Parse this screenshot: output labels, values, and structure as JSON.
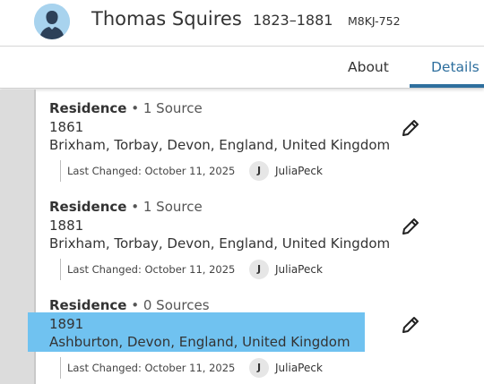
{
  "person": {
    "name": "Thomas Squires",
    "lifespan": "1823–1881",
    "id": "M8KJ-752",
    "avatar_icon": "person-silhouette-icon"
  },
  "tabs": [
    {
      "label": "About",
      "active": false
    },
    {
      "label": "Details",
      "active": true
    }
  ],
  "colors": {
    "accent": "#2e6f9e",
    "selection_highlight": "#70c2f0",
    "left_rail": "#dcdcdc"
  },
  "entries": [
    {
      "label": "Residence",
      "separator": "•",
      "sources": "1 Source",
      "year": "1861",
      "place": "Brixham, Torbay, Devon, England, United Kingdom",
      "last_changed": "Last Changed: October 11, 2025",
      "user_initial": "J",
      "user": "JuliaPeck",
      "edit_icon": "pencil-icon"
    },
    {
      "label": "Residence",
      "separator": "•",
      "sources": "1 Source",
      "year": "1881",
      "place": "Brixham, Torbay, Devon, England, United Kingdom",
      "last_changed": "Last Changed: October 11, 2025",
      "user_initial": "J",
      "user": "JuliaPeck",
      "edit_icon": "pencil-icon"
    },
    {
      "label": "Residence",
      "separator": "•",
      "sources": "0 Sources",
      "year": "1891",
      "place": "Ashburton, Devon, England, United Kingdom",
      "last_changed": "Last Changed: October 11, 2025",
      "user_initial": "J",
      "user": "JuliaPeck",
      "edit_icon": "pencil-icon",
      "selected": true
    }
  ]
}
